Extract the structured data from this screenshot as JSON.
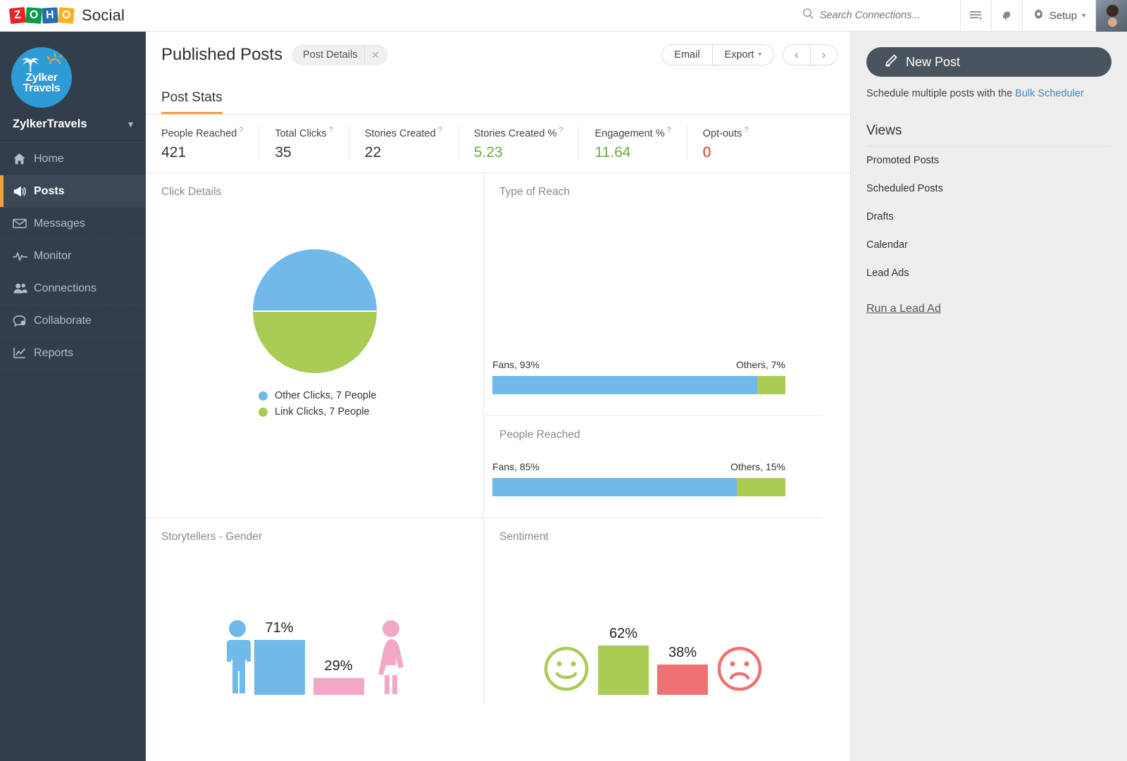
{
  "topbar": {
    "logo_text": "Social",
    "logo_letters": [
      "Z",
      "O",
      "H",
      "O"
    ],
    "search": {
      "placeholder": "Search Connections...",
      "value": ""
    },
    "setup_label": "Setup"
  },
  "sidebar": {
    "brand_logo_text_line1": "Zylker",
    "brand_logo_text_line2": "Travels",
    "brand_name": "ZylkerTravels",
    "items": [
      {
        "label": "Home",
        "icon": "home-icon",
        "active": false
      },
      {
        "label": "Posts",
        "icon": "megaphone-icon",
        "active": true
      },
      {
        "label": "Messages",
        "icon": "envelope-icon",
        "active": false
      },
      {
        "label": "Monitor",
        "icon": "pulse-icon",
        "active": false
      },
      {
        "label": "Connections",
        "icon": "people-icon",
        "active": false
      },
      {
        "label": "Collaborate",
        "icon": "chat-icon",
        "active": false
      },
      {
        "label": "Reports",
        "icon": "chart-icon",
        "active": false
      }
    ]
  },
  "main": {
    "page_title": "Published Posts",
    "chip_label": "Post Details",
    "email_label": "Email",
    "export_label": "Export",
    "tab_label": "Post Stats",
    "stats": [
      {
        "label": "People Reached",
        "value": "421",
        "color": "default"
      },
      {
        "label": "Total Clicks",
        "value": "35",
        "color": "default"
      },
      {
        "label": "Stories Created",
        "value": "22",
        "color": "default"
      },
      {
        "label": "Stories Created %",
        "value": "5.23",
        "color": "green"
      },
      {
        "label": "Engagement %",
        "value": "11.64",
        "color": "green"
      },
      {
        "label": "Opt-outs",
        "value": "0",
        "color": "red"
      }
    ],
    "panels": {
      "click_details_title": "Click Details",
      "type_of_reach_title": "Type of Reach",
      "people_reached_title": "People Reached",
      "gender_title": "Storytellers - Gender",
      "sentiment_title": "Sentiment"
    }
  },
  "rightpanel": {
    "new_post_label": "New Post",
    "schedule_text": "Schedule multiple posts with the ",
    "bulk_scheduler_label": "Bulk Scheduler",
    "views_title": "Views",
    "views": [
      {
        "label": "Promoted Posts"
      },
      {
        "label": "Scheduled Posts"
      },
      {
        "label": "Drafts"
      },
      {
        "label": "Calendar"
      },
      {
        "label": "Lead Ads"
      }
    ],
    "lead_ad_label": "Run a Lead Ad"
  },
  "colors": {
    "blue": "#70b9e8",
    "green": "#aacc55",
    "pink": "#f3a8c8",
    "red": "#ef7272",
    "accent": "#f0a13a",
    "sidebar": "#333e4d"
  },
  "chart_data": [
    {
      "type": "pie",
      "title": "Click Details",
      "labels": [
        "Other Clicks, 7 People",
        "Link Clicks, 7 People"
      ],
      "values": [
        50,
        50
      ],
      "raw_counts": [
        7,
        7
      ],
      "colors": [
        "#70b9e8",
        "#aacc55"
      ],
      "legend": "bottom"
    },
    {
      "type": "bar",
      "orientation": "horizontal-stacked",
      "title": "Type of Reach",
      "categories": [
        "Fans",
        "Others"
      ],
      "values": [
        93,
        7
      ],
      "tick_labels": [
        "Fans, 93%",
        "Others, 7%"
      ],
      "colors": [
        "#70b9e8",
        "#aacc55"
      ],
      "xlabel": "",
      "ylabel": "",
      "xlim": [
        0,
        100
      ],
      "grid": false
    },
    {
      "type": "bar",
      "orientation": "horizontal-stacked",
      "title": "People Reached",
      "categories": [
        "Fans",
        "Others"
      ],
      "values": [
        85,
        15
      ],
      "tick_labels": [
        "Fans, 85%",
        "Others, 15%"
      ],
      "colors": [
        "#70b9e8",
        "#aacc55"
      ],
      "xlabel": "",
      "ylabel": "",
      "xlim": [
        0,
        100
      ],
      "grid": false
    },
    {
      "type": "bar",
      "title": "Storytellers - Gender",
      "categories": [
        "Male",
        "Female"
      ],
      "values": [
        71,
        29
      ],
      "data_labels": [
        "71%",
        "29%"
      ],
      "colors": [
        "#70b9e8",
        "#f3a8c8"
      ],
      "ylim": [
        0,
        100
      ],
      "grid": false
    },
    {
      "type": "bar",
      "title": "Sentiment",
      "categories": [
        "Positive",
        "Negative"
      ],
      "values": [
        62,
        38
      ],
      "data_labels": [
        "62%",
        "38%"
      ],
      "colors": [
        "#aacc55",
        "#ef7272"
      ],
      "ylim": [
        0,
        100
      ],
      "grid": false
    }
  ]
}
